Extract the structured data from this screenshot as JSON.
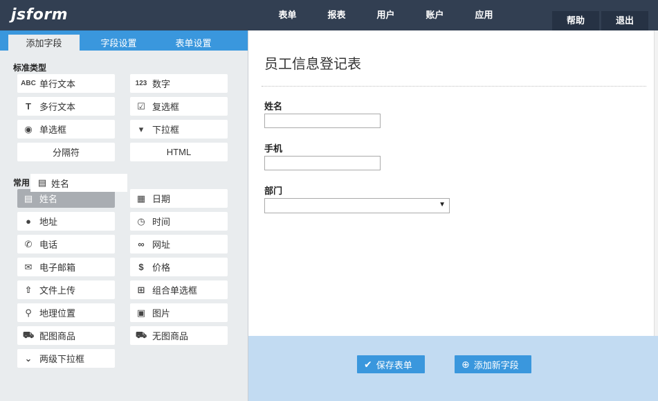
{
  "header": {
    "logo": "jsform",
    "nav": [
      "表单",
      "报表",
      "用户",
      "账户",
      "应用"
    ],
    "help": "帮助",
    "logout": "退出"
  },
  "sidebar": {
    "tabs": [
      "添加字段",
      "字段设置",
      "表单设置"
    ],
    "standard_title": "标准类型",
    "standard_fields": [
      {
        "icon": "ABC",
        "label": "单行文本"
      },
      {
        "icon": "123",
        "label": "数字"
      },
      {
        "icon": "T",
        "label": "多行文本"
      },
      {
        "icon": "☑",
        "label": "复选框"
      },
      {
        "icon": "◉",
        "label": "单选框"
      },
      {
        "icon": "▾",
        "label": "下拉框"
      },
      {
        "label": "分隔符"
      },
      {
        "label": "HTML"
      }
    ],
    "common_title": "常用",
    "drag_ghost": "姓名",
    "common_fields": [
      {
        "icon": "name-card-icon",
        "glyph": "▤",
        "label": "姓名"
      },
      {
        "icon": "calendar-icon",
        "glyph": "▦",
        "label": "日期"
      },
      {
        "icon": "globe-icon",
        "glyph": "●",
        "label": "地址"
      },
      {
        "icon": "clock-icon",
        "glyph": "◷",
        "label": "时间"
      },
      {
        "icon": "phone-icon",
        "glyph": "✆",
        "label": "电话"
      },
      {
        "icon": "link-icon",
        "glyph": "∞",
        "label": "网址"
      },
      {
        "icon": "envelope-icon",
        "glyph": "✉",
        "label": "电子邮箱"
      },
      {
        "icon": "price-tag-icon",
        "glyph": "$",
        "label": "价格"
      },
      {
        "icon": "upload-icon",
        "glyph": "⇧",
        "label": "文件上传"
      },
      {
        "icon": "grid-icon",
        "glyph": "⊞",
        "label": "组合单选框"
      },
      {
        "icon": "map-pin-icon",
        "glyph": "⚲",
        "label": "地理位置"
      },
      {
        "icon": "image-icon",
        "glyph": "▣",
        "label": "图片"
      },
      {
        "icon": "cart-icon",
        "glyph": "⛟",
        "label": "配图商品"
      },
      {
        "icon": "cart-icon",
        "glyph": "⛟",
        "label": "无图商品"
      },
      {
        "icon": "dropdown-icon",
        "glyph": "⌄",
        "label": "两级下拉框"
      }
    ]
  },
  "form": {
    "title": "员工信息登记表",
    "fields": [
      {
        "label": "姓名",
        "value": ""
      },
      {
        "label": "手机",
        "value": ""
      },
      {
        "label": "部门",
        "value": ""
      }
    ],
    "save_button": "保存表单",
    "add_field_button": "添加新字段"
  },
  "colors": {
    "topbar": "#323f52",
    "accent": "#3a97dd",
    "sidebar_bg": "#e9ecee",
    "footer_bg": "#c2dbf2"
  }
}
